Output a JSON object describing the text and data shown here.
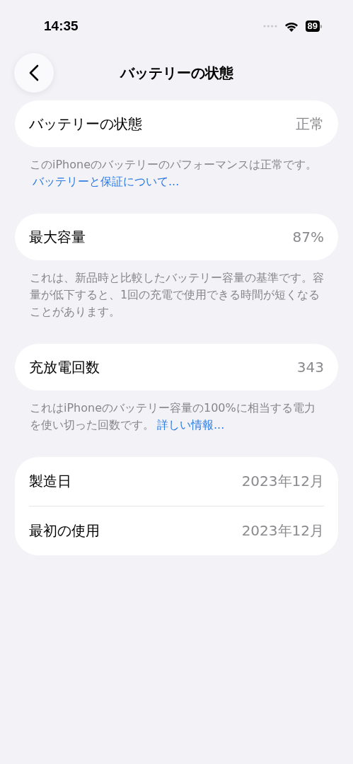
{
  "status_bar": {
    "time": "14:35",
    "battery": "89"
  },
  "nav": {
    "title": "バッテリーの状態"
  },
  "sections": [
    {
      "rows": [
        {
          "label": "バッテリーの状態",
          "value": "正常"
        }
      ],
      "footer": {
        "text": "このiPhoneのバッテリーのパフォーマンスは正常です。",
        "link": "バッテリーと保証について..."
      }
    },
    {
      "rows": [
        {
          "label": "最大容量",
          "value": "87%"
        }
      ],
      "footer": {
        "text": "これは、新品時と比較したバッテリー容量の基準です。容量が低下すると、1回の充電で使用できる時間が短くなることがあります。"
      }
    },
    {
      "rows": [
        {
          "label": "充放電回数",
          "value": "343"
        }
      ],
      "footer": {
        "text": "これはiPhoneのバッテリー容量の100%に相当する電力を使い切った回数です。",
        "link": "詳しい情報..."
      }
    },
    {
      "rows": [
        {
          "label": "製造日",
          "value": "2023年12月"
        },
        {
          "label": "最初の使用",
          "value": "2023年12月"
        }
      ]
    }
  ]
}
